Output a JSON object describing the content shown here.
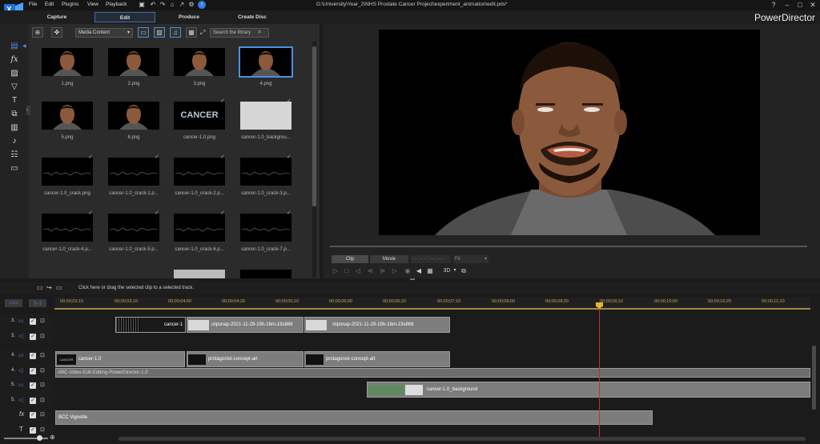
{
  "app": {
    "brand": "PowerDirector",
    "file_path": "G:\\University\\Year_2\\NHS Prostate Cancer Project\\experiment_animation\\edit.pds*"
  },
  "menu": [
    "File",
    "Edit",
    "Plugins",
    "View",
    "Playback"
  ],
  "modes": {
    "capture": "Capture",
    "edit": "Edit",
    "produce": "Produce",
    "create_disc": "Create Disc"
  },
  "library": {
    "media_select": "Media Content",
    "search_placeholder": "Search the library",
    "items": [
      {
        "label": "1.png",
        "kind": "face",
        "check": false,
        "selected": false
      },
      {
        "label": "2.png",
        "kind": "face",
        "check": false,
        "selected": false
      },
      {
        "label": "3.png",
        "kind": "face",
        "check": false,
        "selected": false
      },
      {
        "label": "4.png",
        "kind": "face",
        "check": false,
        "selected": true
      },
      {
        "label": "5.png",
        "kind": "face",
        "check": false,
        "selected": false
      },
      {
        "label": "6.png",
        "kind": "face",
        "check": false,
        "selected": false
      },
      {
        "label": "cancer-1.0.png",
        "kind": "text",
        "check": true,
        "selected": false,
        "text": "CANCER"
      },
      {
        "label": "cancer-1.0_backgrou...",
        "kind": "gray",
        "check": true,
        "selected": false
      },
      {
        "label": "cancer-1.0_crack.png",
        "kind": "crack",
        "check": true,
        "selected": false
      },
      {
        "label": "cancer-1.0_crack-1.p...",
        "kind": "crack",
        "check": true,
        "selected": false
      },
      {
        "label": "cancer-1.0_crack-2.p...",
        "kind": "crack",
        "check": true,
        "selected": false
      },
      {
        "label": "cancer-1.0_crack-3.p...",
        "kind": "crack",
        "check": true,
        "selected": false
      },
      {
        "label": "cancer-1.0_crack-4.p...",
        "kind": "crack",
        "check": true,
        "selected": false
      },
      {
        "label": "cancer-1.0_crack-5.p...",
        "kind": "crack",
        "check": true,
        "selected": false
      },
      {
        "label": "cancer-1.0_crack-6.p...",
        "kind": "crack",
        "check": true,
        "selected": false
      },
      {
        "label": "cancer-1.0_crack-7.p...",
        "kind": "crack",
        "check": true,
        "selected": false
      }
    ]
  },
  "preview": {
    "tab_clip": "Clip",
    "tab_movie": "Movie",
    "timecode": "- - ; - - ; - - ; - -",
    "fit": "Fit",
    "mode_3d": "3D"
  },
  "timeline": {
    "hint": "Click here or drag the selected clip to a selected track.",
    "ticks": [
      "00;00;03;10",
      "00;00;04;00",
      "00;00;04;20",
      "00;00;05;10",
      "00;00;06;00",
      "00;00;06;20",
      "00;00;07;10",
      "00;00;08;00",
      "00;00;08;20",
      "00;00;09;10",
      "00;00;10;00",
      "00;00;10;20",
      "00;00;11;10"
    ],
    "ticks_left": [
      "00;00;03;00",
      "00;00;03;10"
    ],
    "tracks": [
      {
        "num": "3."
      },
      {
        "num": "3."
      },
      {
        "num": "4."
      },
      {
        "num": "4."
      },
      {
        "num": "5."
      },
      {
        "num": "5."
      },
      {
        "num": "fx"
      },
      {
        "num": "T"
      }
    ],
    "clips": {
      "c1": "cancer-1",
      "c2": "clipsnap-2021-11-29-15h-16m-19s868",
      "c3": "clipsnap-2021-11-29-15h-16m-19s868",
      "c4": "cancer-1.0",
      "c5": "protagonist-concept-art",
      "c6": "protagonist-concept-art",
      "c7": "ABC-Video-Edit-Editing-PowerDirector-1.0",
      "c8": "cancer-1.0_background",
      "c9": "BCC Vignette"
    }
  }
}
